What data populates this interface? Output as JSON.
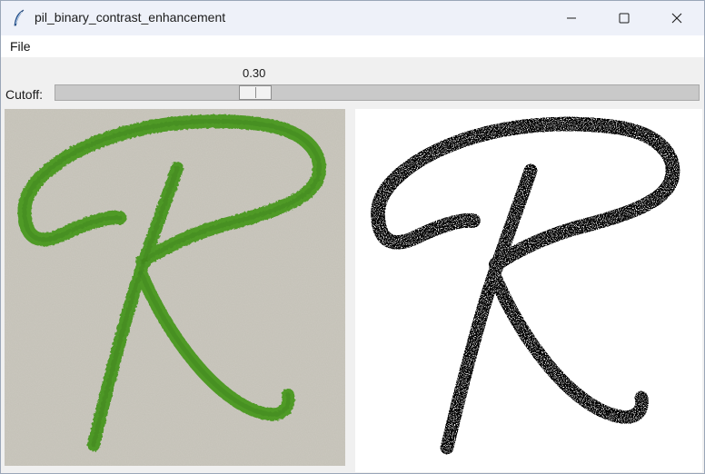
{
  "window": {
    "title": "pil_binary_contrast_enhancement",
    "icon": "feather-icon",
    "controls": [
      "minimize-icon",
      "maximize-icon",
      "close-icon"
    ]
  },
  "menubar": {
    "items": [
      "File"
    ]
  },
  "scale": {
    "label": "Cutoff:",
    "value_text": "0.30",
    "value": 0.3
  },
  "colors": {
    "titlebar": "#eef1f9",
    "paper": "#c3c0b6",
    "ink_green": "#4f9a26",
    "ink_binary": "#000000",
    "trough": "#c9c9c9"
  }
}
